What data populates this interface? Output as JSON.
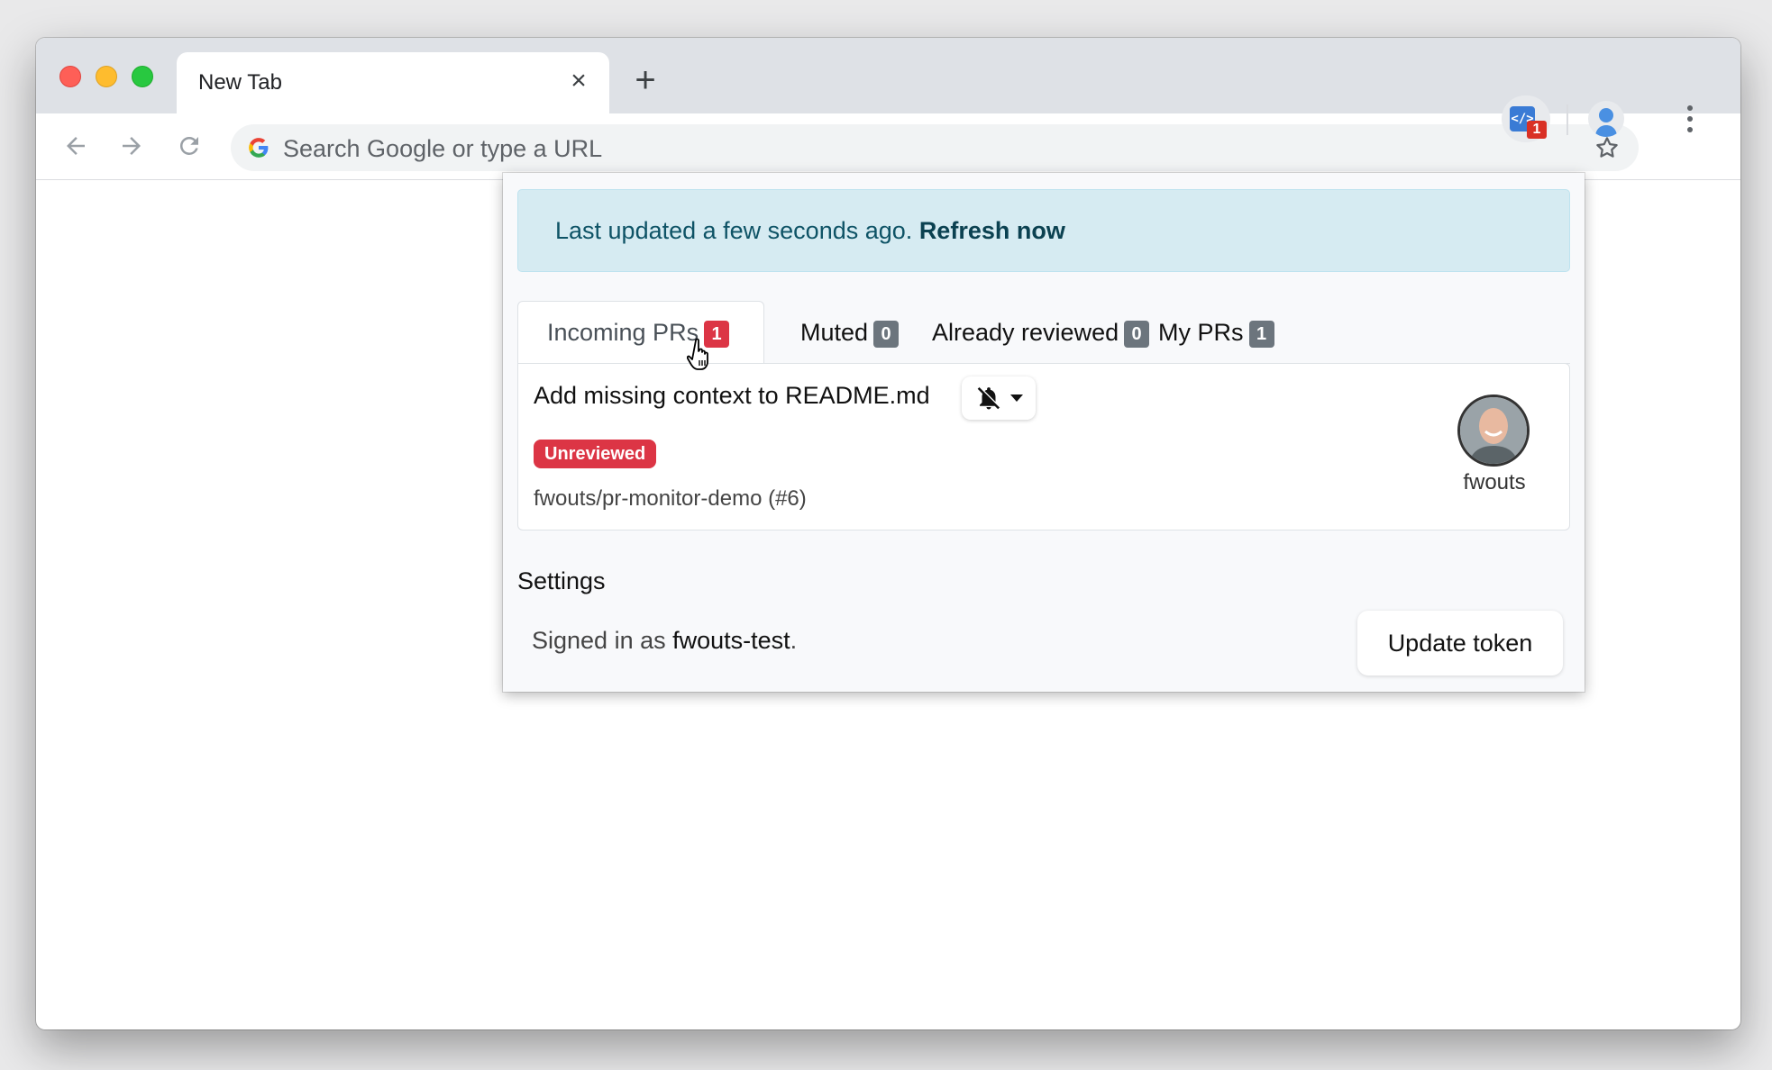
{
  "browser": {
    "tab_title": "New Tab",
    "omnibox_placeholder": "Search Google or type a URL",
    "extension_badge": "1"
  },
  "popup": {
    "alert": {
      "text": "Last updated a few seconds ago.",
      "link": "Refresh now"
    },
    "tabs": [
      {
        "label": "Incoming PRs",
        "count": "1",
        "active": true
      },
      {
        "label": "Muted",
        "count": "0",
        "active": false
      },
      {
        "label": "Already reviewed",
        "count": "0",
        "active": false
      },
      {
        "label": "My PRs",
        "count": "1",
        "active": false
      }
    ],
    "pull_request": {
      "title": "Add missing context to README.md",
      "status_badge": "Unreviewed",
      "repo": "fwouts/pr-monitor-demo (#6)",
      "author": "fwouts"
    },
    "settings": {
      "title": "Settings",
      "signed_in_prefix": "Signed in as",
      "username": "fwouts-test",
      "signed_in_suffix": ".",
      "update_button": "Update token"
    }
  },
  "colors": {
    "alert_bg": "#d6ebf2",
    "danger": "#dc3545",
    "secondary": "#6c757d",
    "extension_icon": "#3a7bd5"
  }
}
